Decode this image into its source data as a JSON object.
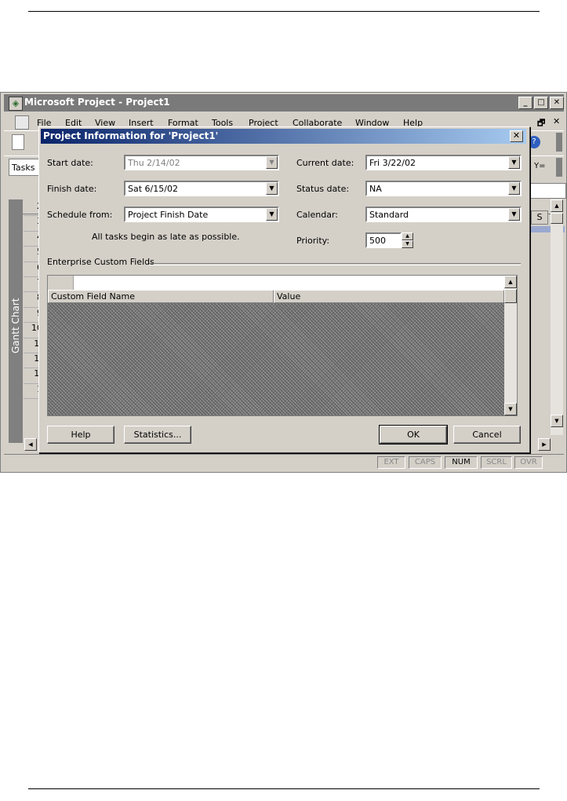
{
  "app": {
    "title": "Microsoft Project - Project1",
    "menu": [
      "File",
      "Edit",
      "View",
      "Insert",
      "Format",
      "Tools",
      "Project",
      "Collaborate",
      "Window",
      "Help"
    ],
    "tasks_button": "Tasks",
    "sidebar_label": "Gantt Chart",
    "row_numbers": [
      "2",
      "3",
      "4",
      "5",
      "6",
      "7",
      "8",
      "9",
      "10",
      "1:",
      "1:",
      "1:",
      "1"
    ],
    "column_header_s": "S",
    "status_indicators": [
      {
        "label": "EXT",
        "active": false
      },
      {
        "label": "CAPS",
        "active": false
      },
      {
        "label": "NUM",
        "active": true
      },
      {
        "label": "SCRL",
        "active": false
      },
      {
        "label": "OVR",
        "active": false
      }
    ]
  },
  "dialog": {
    "title": "Project Information for 'Project1'",
    "close_glyph": "✕",
    "start_date": {
      "label": "Start date:",
      "value": "Thu 2/14/02",
      "disabled": true
    },
    "finish_date": {
      "label": "Finish date:",
      "value": "Sat 6/15/02"
    },
    "schedule_from": {
      "label": "Schedule from:",
      "value": "Project Finish Date"
    },
    "schedule_note": "All tasks begin as late as possible.",
    "current_date": {
      "label": "Current date:",
      "value": "Fri 3/22/02"
    },
    "status_date": {
      "label": "Status date:",
      "value": "NA"
    },
    "calendar": {
      "label": "Calendar:",
      "value": "Standard"
    },
    "priority": {
      "label": "Priority:",
      "value": "500"
    },
    "enterprise_group": "Enterprise Custom Fields",
    "grid_columns": [
      "Custom Field Name",
      "Value"
    ],
    "buttons": {
      "help": "Help",
      "statistics": "Statistics...",
      "ok": "OK",
      "cancel": "Cancel"
    }
  },
  "colors": {
    "dialog_title_start": "#0a246a",
    "dialog_title_end": "#a6caf0",
    "face": "#d4d0c8"
  }
}
